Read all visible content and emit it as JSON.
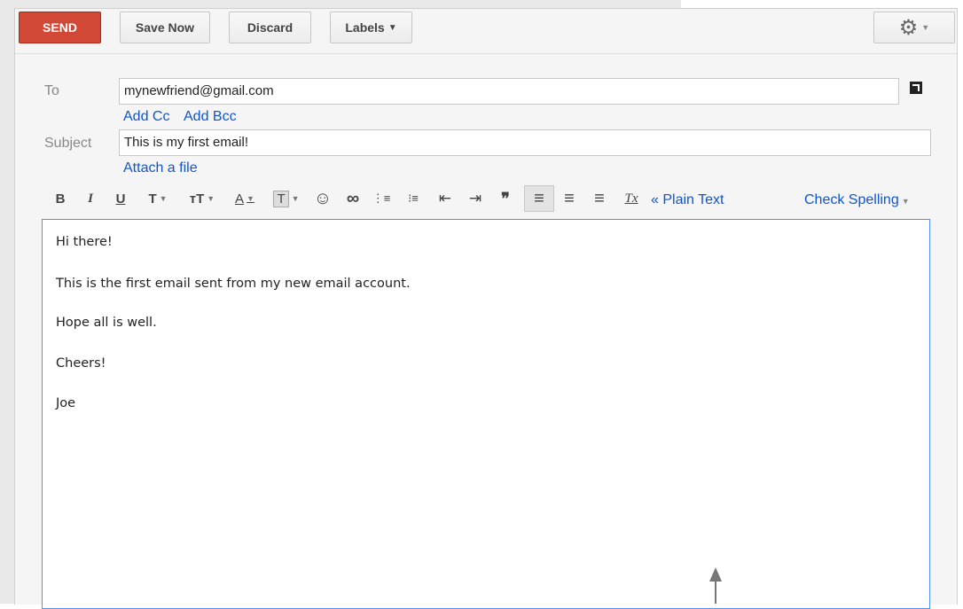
{
  "toolbar": {
    "send_label": "SEND",
    "save_label": "Save Now",
    "discard_label": "Discard",
    "labels_label": "Labels",
    "gear_icon": "gear-icon"
  },
  "compose": {
    "to_label": "To",
    "to_value": "mynewfriend@gmail.com",
    "add_cc": "Add Cc",
    "add_bcc": "Add Bcc",
    "subject_label": "Subject",
    "subject_value": "This is my first email!",
    "attach": "Attach a file"
  },
  "format": {
    "bold": "B",
    "italic": "I",
    "underline": "U",
    "font": "T",
    "size": "тT",
    "text_color": "A",
    "highlight": "T",
    "emoji": "☺",
    "link": "∞",
    "numbered_list": "⋮≡",
    "bullet_list": "⁝≡",
    "indent_less": "⇤",
    "indent_more": "⇥",
    "quote": "❞",
    "align_left": "≡",
    "align_center": "≡",
    "align_right": "≡",
    "remove_format": "Tx",
    "plain_text": "« Plain Text",
    "check_spelling": "Check Spelling"
  },
  "body": {
    "line1": "Hi there!",
    "line2": "This is the first email sent from my new email account.",
    "line3": "Hope all is well.",
    "line4": "Cheers!",
    "line5": "Joe"
  },
  "colors": {
    "send": "#d14836",
    "link": "#1155cc",
    "focus": "#4d90fe"
  }
}
